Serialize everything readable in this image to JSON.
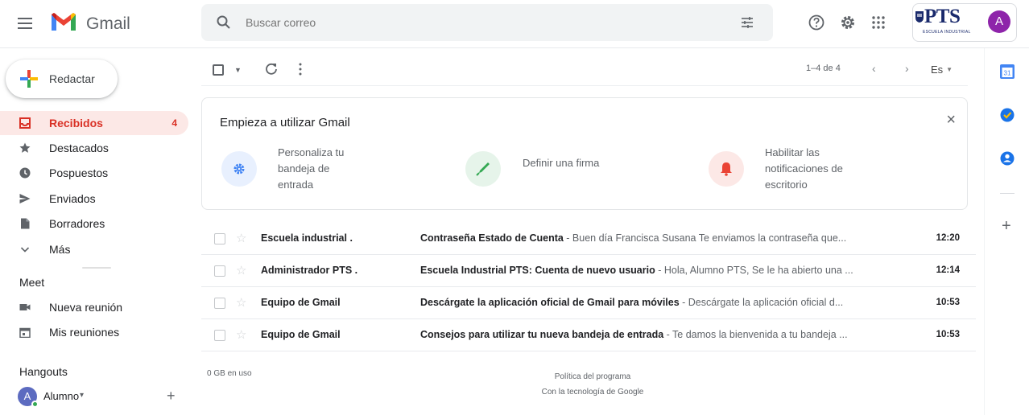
{
  "header": {
    "brand": "Gmail",
    "search_placeholder": "Buscar correo",
    "org": {
      "name": "PTS",
      "subtitle": "ESCUELA INDUSTRIAL"
    },
    "avatar_letter": "A"
  },
  "sidebar": {
    "compose_label": "Redactar",
    "items": [
      {
        "label": "Recibidos",
        "count": "4",
        "icon": "inbox-icon"
      },
      {
        "label": "Destacados",
        "icon": "star-icon"
      },
      {
        "label": "Pospuestos",
        "icon": "clock-icon"
      },
      {
        "label": "Enviados",
        "icon": "send-icon"
      },
      {
        "label": "Borradores",
        "icon": "draft-icon"
      },
      {
        "label": "Más",
        "icon": "chevron-down-icon"
      }
    ],
    "meet": {
      "title": "Meet",
      "items": [
        {
          "label": "Nueva reunión",
          "icon": "video-icon"
        },
        {
          "label": "Mis reuniones",
          "icon": "calendar-icon"
        }
      ]
    },
    "hangouts": {
      "title": "Hangouts",
      "user": "Alumno",
      "avatar_letter": "A"
    }
  },
  "toolbar": {
    "pager": "1–4 de 4",
    "language": "Es"
  },
  "onboarding": {
    "title": "Empieza a utilizar Gmail",
    "close": "×",
    "features": [
      {
        "label": "Personaliza tu bandeja de entrada",
        "color": "#e8f0fe",
        "icon": "gear-icon"
      },
      {
        "label": "Definir una firma",
        "color": "#e6f4ea",
        "icon": "pen-icon"
      },
      {
        "label": "Habilitar las notificaciones de escritorio",
        "color": "#fce8e6",
        "icon": "bell-icon"
      }
    ],
    "feature_lines": [
      [
        "Personaliza tu",
        "bandeja de",
        "entrada"
      ],
      [
        "Definir una firma"
      ],
      [
        "Habilitar las",
        "notificaciones de",
        "escritorio"
      ]
    ]
  },
  "emails": [
    {
      "sender": "Escuela industrial .",
      "subject": "Contraseña Estado de Cuenta",
      "snippet": " - Buen día Francisca Susana Te enviamos la contraseña que...",
      "time": "12:20"
    },
    {
      "sender": "Administrador PTS .",
      "subject": "Escuela Industrial PTS: Cuenta de nuevo usuario",
      "snippet": " - Hola, Alumno PTS, Se le ha abierto una ...",
      "time": "12:14"
    },
    {
      "sender": "Equipo de Gmail",
      "subject": "Descárgate la aplicación oficial de Gmail para móviles",
      "snippet": " - Descárgate la aplicación oficial d...",
      "time": "10:53"
    },
    {
      "sender": "Equipo de Gmail",
      "subject": "Consejos para utilizar tu nueva bandeja de entrada",
      "snippet": " - Te damos la bienvenida a tu bandeja ...",
      "time": "10:53"
    }
  ],
  "footer": {
    "usage": "0 GB en uso",
    "policy": "Política del programa",
    "powered": "Con la tecnología de Google"
  },
  "colors": {
    "accent_red": "#d93025",
    "active_bg": "#fce8e6",
    "avatar_purple": "#8e24aa",
    "hangouts_avatar": "#5c6bc0"
  }
}
